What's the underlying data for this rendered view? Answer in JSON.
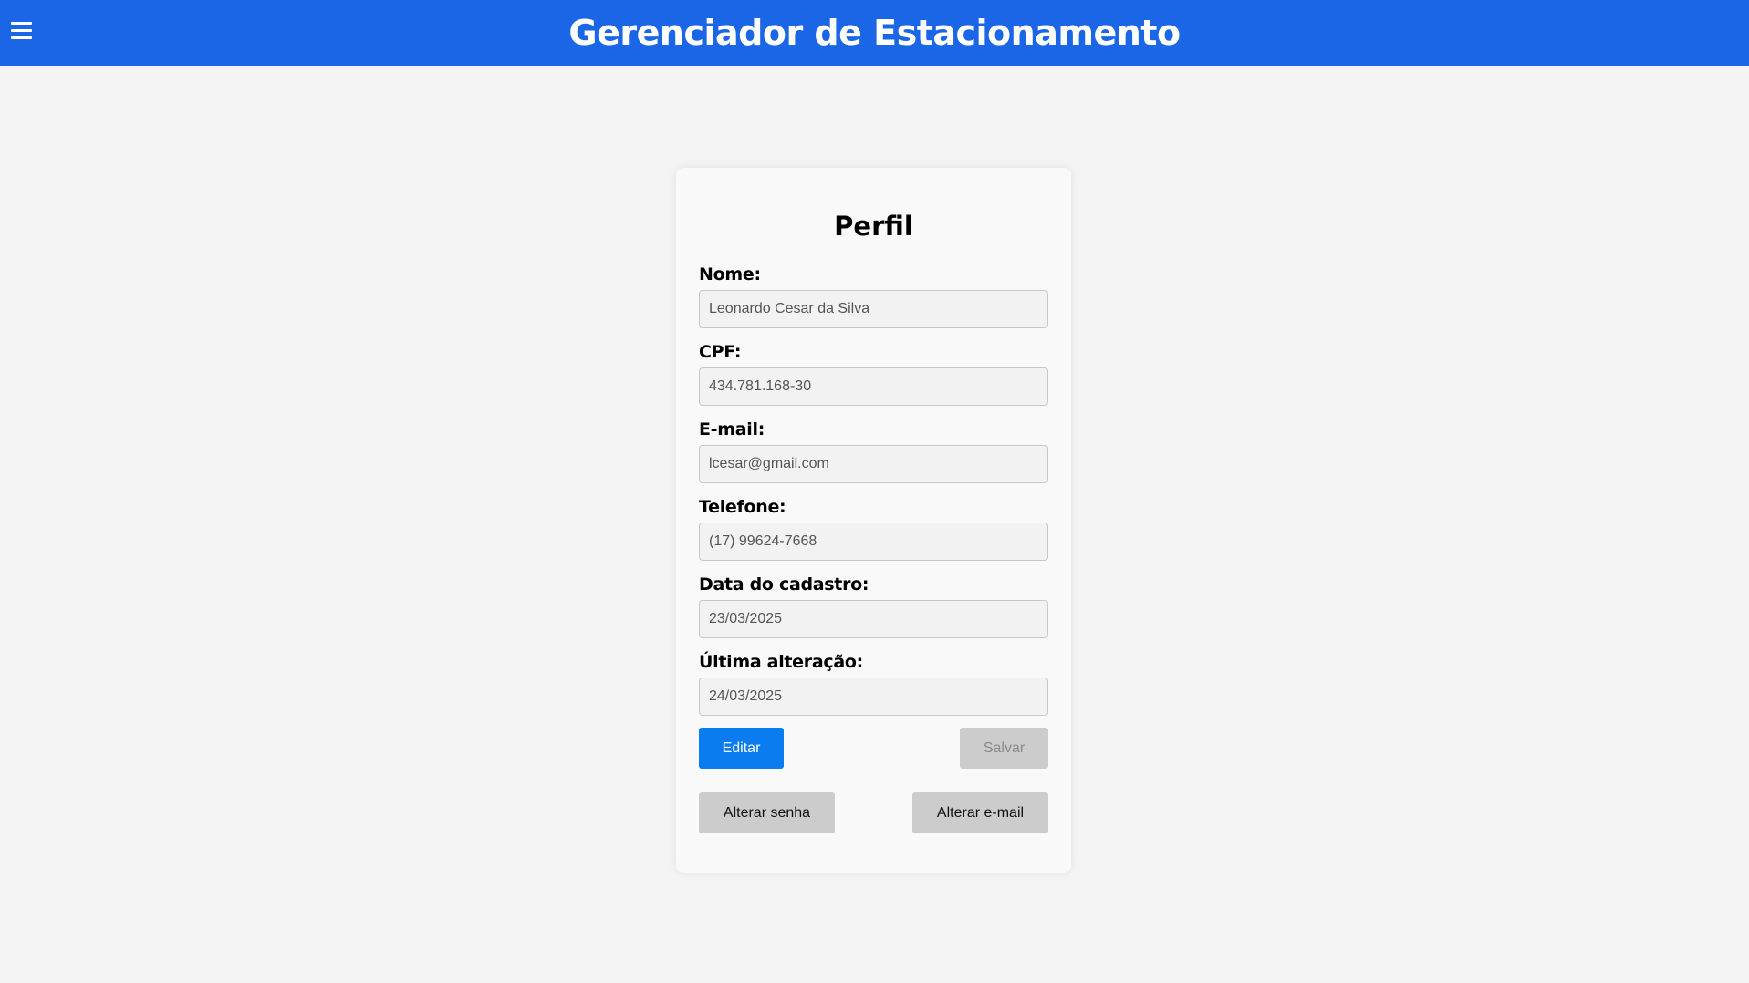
{
  "header": {
    "title": "Gerenciador de Estacionamento",
    "menu_icon": "hamburger-menu-icon",
    "background_color": "#1a66e6"
  },
  "profile": {
    "title": "Perfil",
    "fields": [
      {
        "label": "Nome:",
        "value": "Leonardo Cesar da Silva"
      },
      {
        "label": "CPF:",
        "value": "434.781.168-30"
      },
      {
        "label": "E-mail:",
        "value": "lcesar@gmail.com"
      },
      {
        "label": "Telefone:",
        "value": "(17) 99624-7668"
      },
      {
        "label": "Data do cadastro:",
        "value": "23/03/2025"
      },
      {
        "label": "Última alteração:",
        "value": "24/03/2025"
      }
    ],
    "buttons": {
      "edit": "Editar",
      "save": "Salvar",
      "change_password": "Alterar senha",
      "change_email": "Alterar e-mail"
    },
    "colors": {
      "primary_button": "#0a7cf0",
      "disabled_button": "#cccccc"
    }
  }
}
